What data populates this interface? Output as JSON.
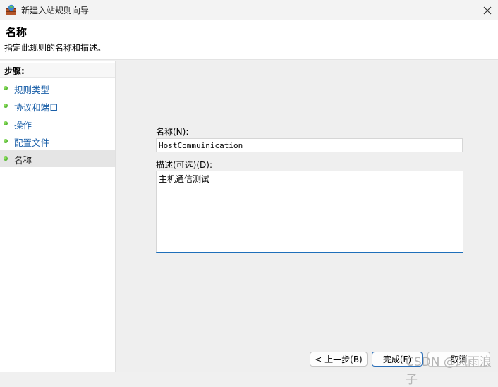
{
  "window": {
    "title": "新建入站规则向导",
    "close_icon": "close-icon"
  },
  "header": {
    "title": "名称",
    "description": "指定此规则的名称和描述。"
  },
  "sidebar": {
    "heading": "步骤:",
    "items": [
      {
        "label": "规则类型",
        "active": false
      },
      {
        "label": "协议和端口",
        "active": false
      },
      {
        "label": "操作",
        "active": false
      },
      {
        "label": "配置文件",
        "active": false
      },
      {
        "label": "名称",
        "active": true
      }
    ]
  },
  "form": {
    "name_label": "名称(N):",
    "name_value": "HostCommuinication",
    "description_label": "描述(可选)(D):",
    "description_value": "主机通信测试"
  },
  "buttons": {
    "back": "< 上一步(B)",
    "finish": "完成(F)",
    "cancel": "取消"
  },
  "watermark": "CSDN @风雨浪子",
  "colors": {
    "link": "#1a5fa8",
    "focus_border": "#1e6fba",
    "step_dot": "#2e9a12"
  }
}
